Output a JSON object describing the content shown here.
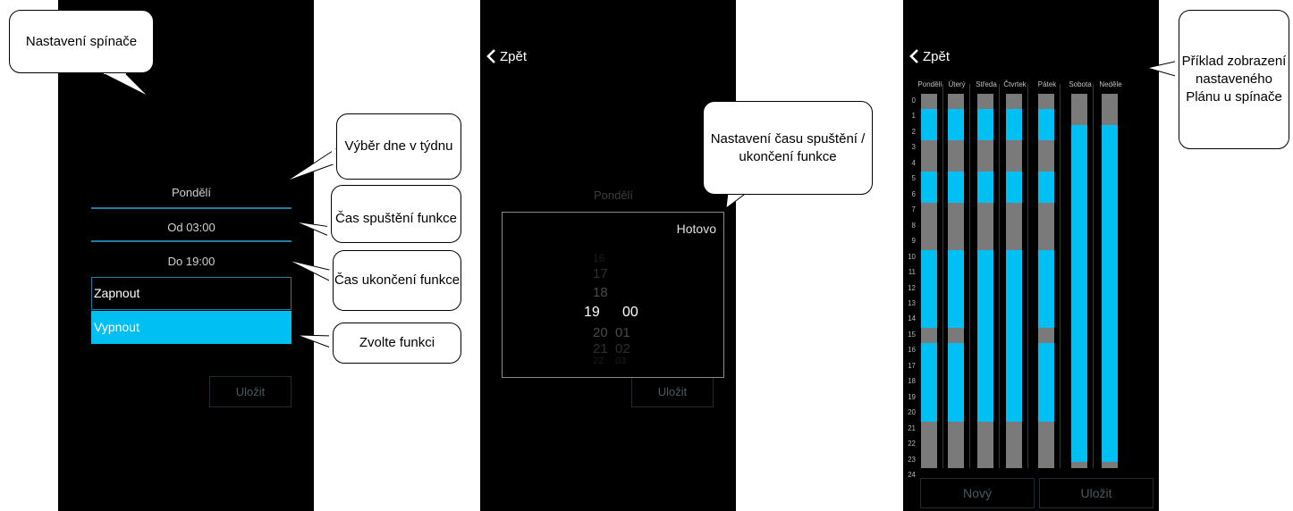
{
  "screens": {
    "switch_settings": {
      "day": "Pondělí",
      "from": "Od 03:00",
      "to": "Do 19:00",
      "options": [
        "Zapnout",
        "Vypnout"
      ],
      "selected_option": "Vypnout",
      "save": "Uložit"
    },
    "time_picker": {
      "back": "Zpět",
      "day": "Pondělí",
      "done": "Hotovo",
      "hours": [
        "16",
        "17",
        "18",
        "19",
        "20",
        "21",
        "22"
      ],
      "minutes": [
        "00",
        "01",
        "02",
        "03"
      ],
      "selected_hour": "19",
      "selected_minute": "00",
      "save": "Uložit"
    },
    "schedule": {
      "back": "Zpět",
      "days": [
        "Pondělí",
        "Úterý",
        "Středa",
        "Čtvrtek",
        "Pátek",
        "Sobota",
        "Neděle"
      ],
      "hours": [
        "0",
        "1",
        "2",
        "3",
        "4",
        "5",
        "6",
        "7",
        "8",
        "9",
        "10",
        "11",
        "12",
        "13",
        "14",
        "15",
        "16",
        "17",
        "18",
        "19",
        "20",
        "21",
        "22",
        "23",
        "24"
      ],
      "on_intervals": [
        [
          [
            1,
            3
          ],
          [
            5,
            7
          ],
          [
            10,
            15
          ],
          [
            16,
            21
          ]
        ],
        [
          [
            1,
            3
          ],
          [
            5,
            7
          ],
          [
            10,
            15
          ],
          [
            16,
            21
          ]
        ],
        [
          [
            1,
            3
          ],
          [
            5,
            7
          ],
          [
            10,
            21
          ]
        ],
        [
          [
            1,
            3
          ],
          [
            5,
            7
          ],
          [
            10,
            21
          ]
        ],
        [
          [
            1,
            3
          ],
          [
            5,
            7
          ],
          [
            10,
            15
          ],
          [
            16,
            21
          ]
        ],
        [
          [
            2,
            23.6
          ]
        ],
        [
          [
            2,
            23.6
          ]
        ]
      ],
      "new": "Nový",
      "save": "Uložit"
    }
  },
  "callouts": [
    "Nastavení spínače",
    "Výběr dne v týdnu",
    "Čas spuštění funkce",
    "Čas ukončení funkce",
    "Zvolte funkci",
    "Nastavení času spuštění / ukončení funkce",
    "Příklad zobrazení nastaveného Plánu u spínače"
  ],
  "colors": {
    "on": "#00bff3",
    "off": "#7a7a7a",
    "accent": "#1a7fa0",
    "background": "#000000"
  }
}
